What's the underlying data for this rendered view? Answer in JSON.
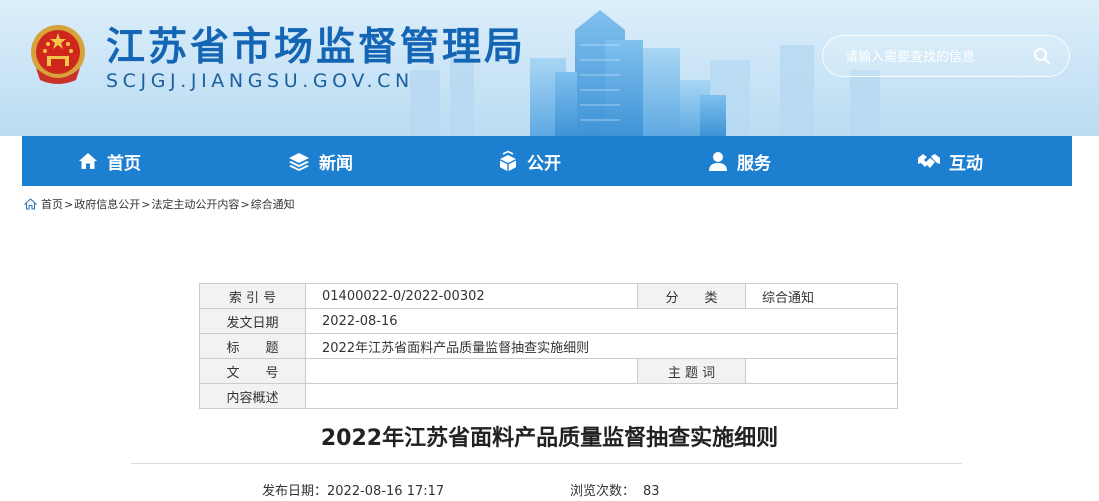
{
  "header": {
    "title": "江苏省市场监督管理局",
    "domain": "SCJGJ.JIANGSU.GOV.CN",
    "search_placeholder": "请输入需要查找的信息"
  },
  "nav": {
    "items": [
      {
        "label": "首页",
        "icon": "home-icon"
      },
      {
        "label": "新闻",
        "icon": "layers-icon"
      },
      {
        "label": "公开",
        "icon": "open-box-icon"
      },
      {
        "label": "服务",
        "icon": "person-icon"
      },
      {
        "label": "互动",
        "icon": "handshake-icon"
      }
    ],
    "color": "#1d7fcf"
  },
  "breadcrumb": {
    "icon": "home-icon",
    "items": [
      "首页",
      "政府信息公开",
      "法定主动公开内容",
      "综合通知"
    ],
    "separator": ">"
  },
  "meta": {
    "index_label": "索 引 号",
    "index_value": "01400022-0/2022-00302",
    "category_label": "分　　类",
    "category_value": "综合通知",
    "date_label": "发文日期",
    "date_value": "2022-08-16",
    "title_label": "标　　题",
    "title_value": "2022年江苏省面料产品质量监督抽查实施细则",
    "docno_label": "文　　号",
    "docno_value": "",
    "keywords_label": "主 题 词",
    "keywords_value": "",
    "summary_label": "内容概述",
    "summary_value": ""
  },
  "article": {
    "title": "2022年江苏省面料产品质量监督抽查实施细则",
    "publish_label": "发布日期：",
    "publish_value": "2022-08-16 17:17",
    "views_label": "浏览次数：",
    "views_value": "83"
  }
}
